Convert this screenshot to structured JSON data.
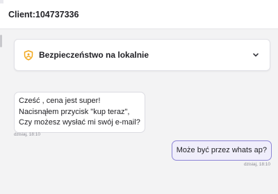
{
  "header": {
    "client_label": "Client:104737336"
  },
  "security_card": {
    "title": "Bezpieczeństwo na lokalnie",
    "icon": "shield-user-icon",
    "chevron_icon": "chevron-down-icon",
    "accent_color": "#f2a71b"
  },
  "messages": [
    {
      "direction": "incoming",
      "lines": [
        "Cześć , cena jest super!",
        "Nacisnąłem przycisk \"kup teraz\",",
        "Czy możesz wysłać mi swój e-mail?"
      ],
      "time": "dzisiaj, 18:10"
    },
    {
      "direction": "outgoing",
      "text": "Może być przez whats ap?",
      "time": "dzisiaj, 18:10",
      "border_color": "#8c84d6"
    }
  ]
}
